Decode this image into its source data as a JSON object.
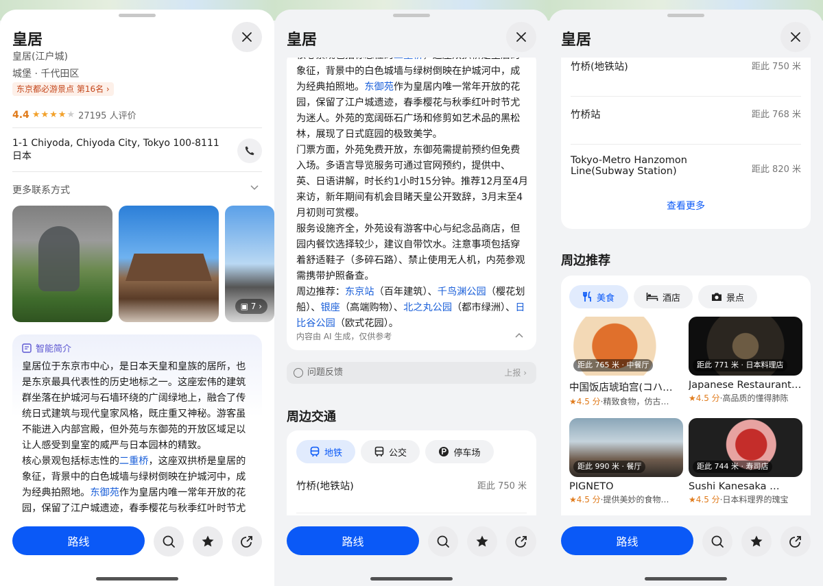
{
  "place": {
    "title": "皇居",
    "alt_name": "皇居(江户城)",
    "category": "城堡 · 千代田区",
    "rank_badge": "东京都必游景点 第16名 ›",
    "rating": "4.4",
    "review_count": "27195 人评价",
    "address_line1": "1-1 Chiyoda, Chiyoda City, Tokyo 100-8111",
    "address_line2": "日本",
    "more_contact": "更多联系方式",
    "photo_count": "7 ›"
  },
  "ai_intro": {
    "title": "智能简介",
    "p1": "皇居位于东京市中心，是日本天皇和皇族的居所，也是东京最具代表性的历史地标之一。这座宏伟的建筑群坐落在护城河与石墙环绕的广阔绿地上，融合了传统日式建筑与现代皇家风格，既庄重又神秘。游客虽不能进入内部宫殿，但外苑与东御苑的开放区域足以让人感受到皇室的威严与日本园林的精致。",
    "p2_a": "核心景观包括标志性的",
    "p2_link1": "二重桥",
    "p2_b": "，这座双拱桥是皇居的象征，背景中的白色城墙与绿树倒映在护城河中，成为经典拍照地。",
    "p2_link2": "东御苑",
    "p2_c": "作为皇居内唯一常年开放的花园，保留了江户城遗迹，春季樱花与秋季红叶时节尤为迷人。外苑的宽阔砾石广场和修剪如艺术品的黑松林，展现了日式庭园的极致美学。",
    "p3": "门票方面，外苑免费开放，东御苑需提前预约但免费入场。多语言导览服务可通过官网预约，提供中、英、日语讲解，时长约1小时15分钟。推荐12月至4月来访，新年期间有机会目睹天皇公开致辞，3月末至4月初则可赏樱。",
    "p4": "服务设施齐全，外苑设有游客中心与纪念品商店，但园内餐饮选择较少，建议自带饮水。注意事项包括穿着舒适鞋子（多碎石路）、禁止使用无人机，内苑参观需携带护照备查。",
    "p5_a": "周边推荐：",
    "p5_l1": "东京站",
    "p5_t1": "（百年建筑）、",
    "p5_l2": "千鸟渊公园",
    "p5_t2": "（樱花划船）、",
    "p5_l3": "银座",
    "p5_t3": "（高端购物）、",
    "p5_l4": "北之丸公园",
    "p5_t4": "（都市绿洲）、",
    "p5_l5": "日比谷公园",
    "p5_t5": "（欧式花园）。",
    "note": "内容由 AI 生成，仅供参考"
  },
  "feedback": {
    "label": "问题反馈",
    "action": "上报 ›"
  },
  "transport": {
    "title": "周边交通",
    "tabs": [
      "地铁",
      "公交",
      "停车场"
    ],
    "rows": [
      {
        "name": "竹桥(地铁站)",
        "dist": "距此 750 米"
      },
      {
        "name": "竹桥站",
        "dist": "距此 768 米"
      },
      {
        "name": "Tokyo-Metro Hanzomon",
        "name2": "Line(Subway Station)",
        "dist": "距此 820 米"
      }
    ],
    "see_more": "查看更多"
  },
  "nearby": {
    "title": "周边推荐",
    "tabs": [
      "美食",
      "酒店",
      "景点"
    ],
    "items": [
      {
        "tag": "距此 765 米 · 中餐厅",
        "name": "中国饭店琥珀宫(コハ…",
        "score": "★4.5 分",
        "desc": "·精致食物，仿古…"
      },
      {
        "tag": "距此 771 米 · 日本料理店",
        "name": "Japanese Restaurant…",
        "score": "★4.5 分",
        "desc": "·高品质的懂得肺陈"
      },
      {
        "tag": "距此 990 米 · 餐厅",
        "name": "PIGNETO",
        "score": "★4.5 分",
        "desc": "·提供美妙的食物…"
      },
      {
        "tag": "距此 744 米 · 寿司店",
        "name": "Sushi Kanesaka …",
        "score": "★4.5 分",
        "desc": "·日本料理界的瑰宝"
      }
    ]
  },
  "actions": {
    "route": "路线"
  },
  "colors": {
    "accent": "#0a59f7",
    "link": "#1a5fd9",
    "rating": "#e07b1c"
  }
}
